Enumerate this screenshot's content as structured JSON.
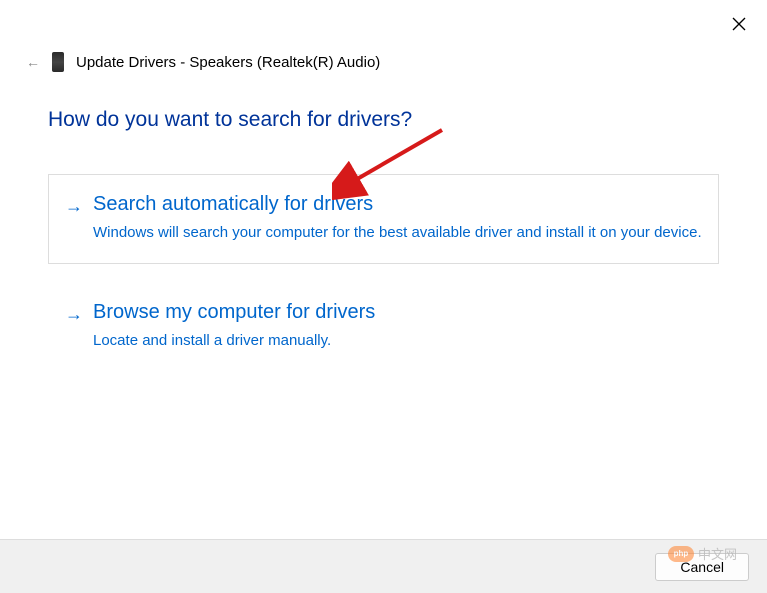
{
  "window_title": "Update Drivers - Speakers (Realtek(R) Audio)",
  "heading": "How do you want to search for drivers?",
  "options": [
    {
      "title": "Search automatically for drivers",
      "description": "Windows will search your computer for the best available driver and install it on your device."
    },
    {
      "title": "Browse my computer for drivers",
      "description": "Locate and install a driver manually."
    }
  ],
  "cancel_label": "Cancel",
  "watermark_text": "中文网",
  "watermark_logo": "php"
}
